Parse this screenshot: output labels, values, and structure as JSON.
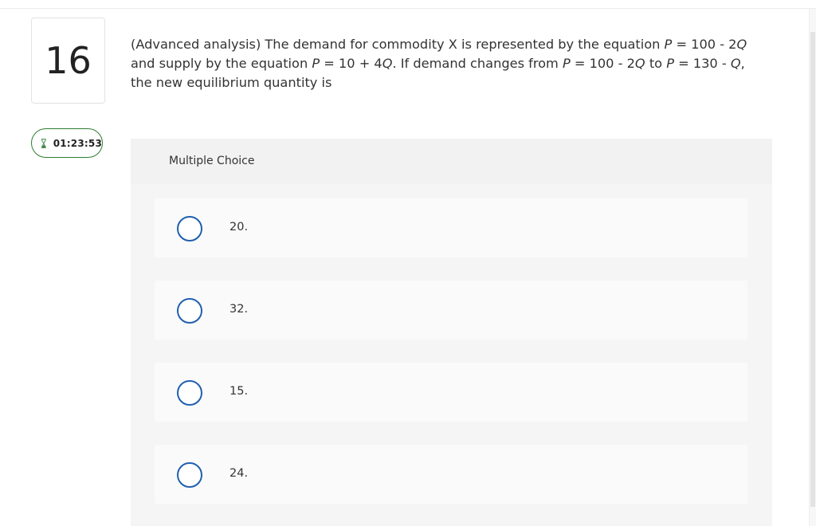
{
  "question": {
    "number": "16",
    "timer": "01:23:53",
    "text_parts": [
      {
        "t": "(Advanced analysis) The demand for commodity X is represented by the equation "
      },
      {
        "t": "P",
        "i": true
      },
      {
        "t": " = 100 - 2"
      },
      {
        "t": "Q",
        "i": true
      },
      {
        "t": " and supply by the equation "
      },
      {
        "t": "P",
        "i": true
      },
      {
        "t": " = 10 + 4"
      },
      {
        "t": "Q",
        "i": true
      },
      {
        "t": ". If demand changes from "
      },
      {
        "t": "P",
        "i": true
      },
      {
        "t": " = 100 - 2"
      },
      {
        "t": "Q",
        "i": true
      },
      {
        "t": " to "
      },
      {
        "t": "P",
        "i": true
      },
      {
        "t": " = 130 - "
      },
      {
        "t": "Q",
        "i": true
      },
      {
        "t": ", the new equilibrium quantity is"
      }
    ]
  },
  "multiple_choice": {
    "label": "Multiple Choice",
    "options": [
      {
        "label": "20."
      },
      {
        "label": "32."
      },
      {
        "label": "15."
      },
      {
        "label": "24."
      }
    ]
  },
  "icons": {
    "timer_icon": "hourglass-icon",
    "radio_icon": "radio-circle-icon"
  },
  "colors": {
    "timer_border": "#2e7d32",
    "hourglass": "#2e7d32",
    "radio": "#1f5fb0"
  }
}
